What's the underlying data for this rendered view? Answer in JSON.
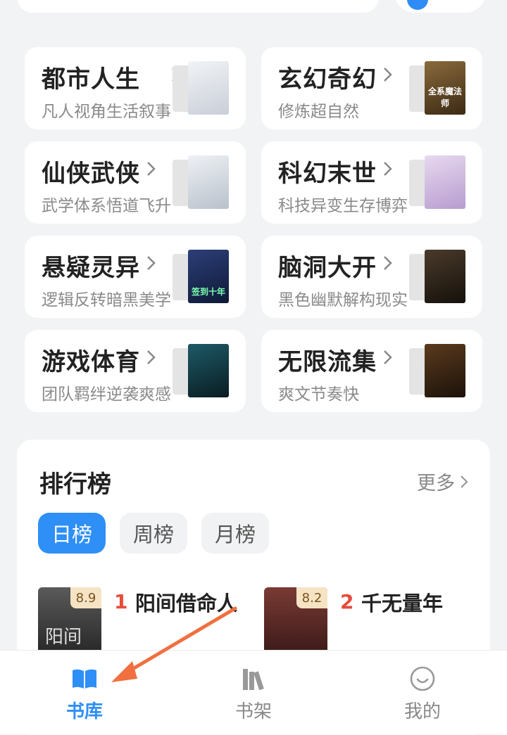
{
  "categories": [
    {
      "title": "都市人生",
      "subtitle": "凡人视角生活叙事",
      "cover_text": "",
      "cover_bg": "#dfe3ea",
      "cover_fg": "#2b2b2b"
    },
    {
      "title": "玄幻奇幻",
      "subtitle": "修炼超自然",
      "cover_text": "全系魔法师",
      "cover_bg": "#4d3a22",
      "cover_fg": "#ffffff"
    },
    {
      "title": "仙侠武侠",
      "subtitle": "武学体系悟道飞升",
      "cover_text": "",
      "cover_bg": "#d9dde3",
      "cover_fg": "#2b2b2b"
    },
    {
      "title": "科幻末世",
      "subtitle": "科技异变生存博弈",
      "cover_text": "",
      "cover_bg": "#d7c7e2",
      "cover_fg": "#4b2f6a"
    },
    {
      "title": "悬疑灵异",
      "subtitle": "逻辑反转暗黑美学",
      "cover_text": "签到十年",
      "cover_bg": "#1e2c55",
      "cover_fg": "#7dffb0"
    },
    {
      "title": "脑洞大开",
      "subtitle": "黑色幽默解构现实",
      "cover_text": "",
      "cover_bg": "#2a221b",
      "cover_fg": "#f5d07a"
    },
    {
      "title": "游戏体育",
      "subtitle": "团队羁绊逆袭爽感",
      "cover_text": "",
      "cover_bg": "#123a44",
      "cover_fg": "#cfeaf0"
    },
    {
      "title": "无限流集",
      "subtitle": "爽文节奏快",
      "cover_text": "",
      "cover_bg": "#2b1d14",
      "cover_fg": "#f0c45a"
    }
  ],
  "ranking": {
    "title": "排行榜",
    "more": "更多",
    "tabs": [
      "日榜",
      "周榜",
      "月榜"
    ],
    "active_tab": "日榜",
    "books": [
      {
        "rank": "1",
        "name": "阳间借命人",
        "score": "8.9",
        "cover_text": "阳间",
        "cover_bg": "#2e2e2e"
      },
      {
        "rank": "2",
        "name": "千无量年",
        "score": "8.2",
        "cover_text": "",
        "cover_bg": "#4a2020"
      }
    ]
  },
  "nav": {
    "items": [
      {
        "label": "书库",
        "icon": "book-open-icon",
        "active": true
      },
      {
        "label": "书架",
        "icon": "bookshelf-icon",
        "active": false
      },
      {
        "label": "我的",
        "icon": "smiley-icon",
        "active": false
      }
    ]
  },
  "colors": {
    "accent": "#2e8ff7",
    "rank_red": "#e74c3c",
    "annotation_arrow": "#f07040"
  }
}
